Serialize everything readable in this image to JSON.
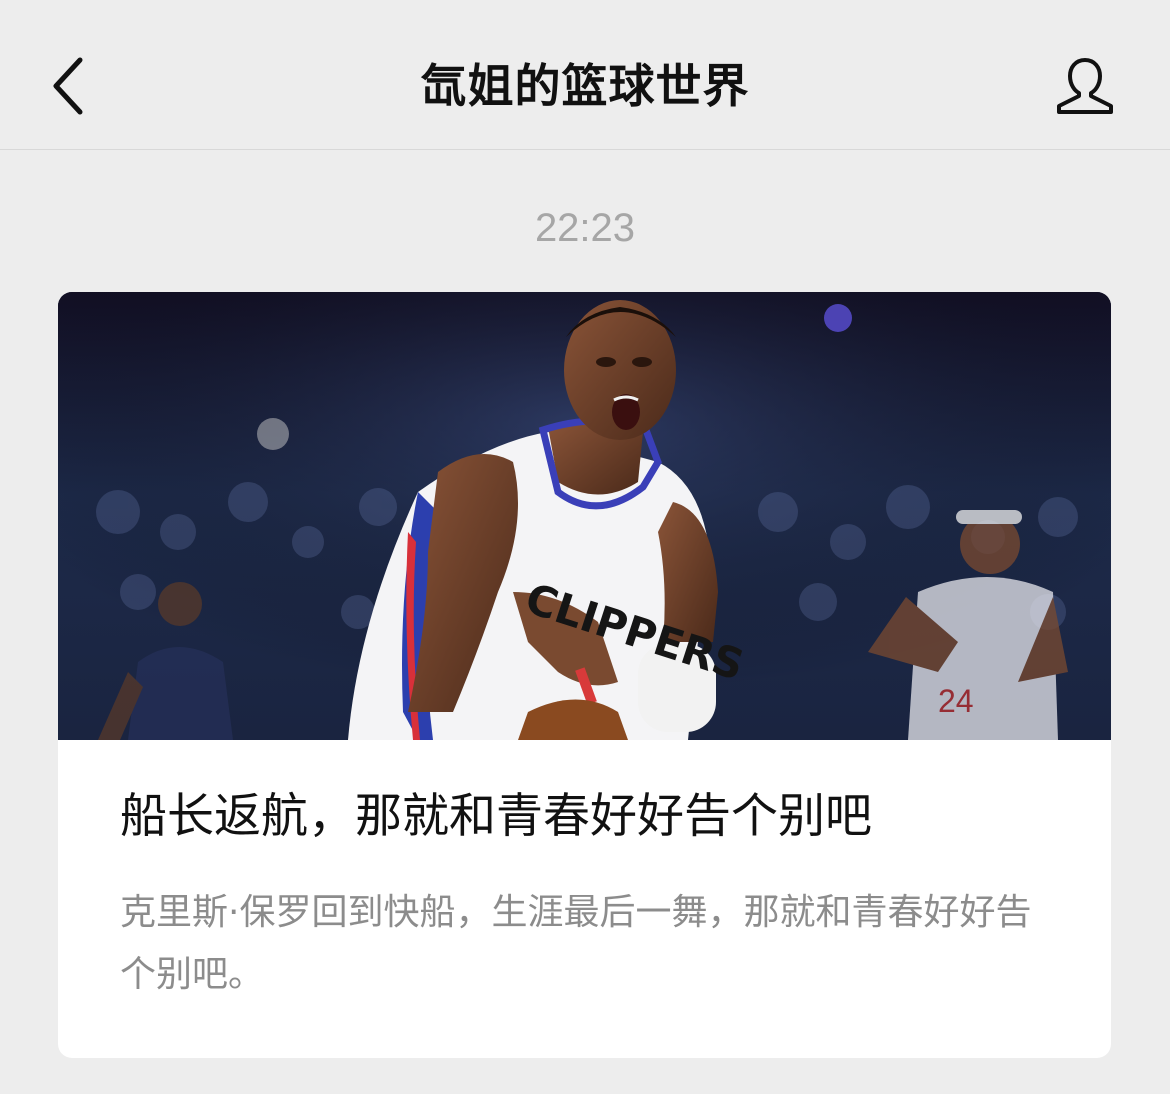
{
  "header": {
    "title": "氙姐的篮球世界",
    "back_icon": "chevron-left-icon",
    "profile_icon": "person-icon"
  },
  "message": {
    "time": "22:23"
  },
  "article": {
    "title": "船长返航，那就和青春好好告个别吧",
    "description": "克里斯·保罗回到快船，生涯最后一舞，那就和青春好好告个别吧。",
    "jersey_text": "CLIPPERS"
  },
  "colors": {
    "background": "#ededed",
    "card": "#ffffff",
    "title_text": "#111111",
    "secondary_text": "#8c8c8c",
    "timestamp_text": "#a6a6a6"
  }
}
